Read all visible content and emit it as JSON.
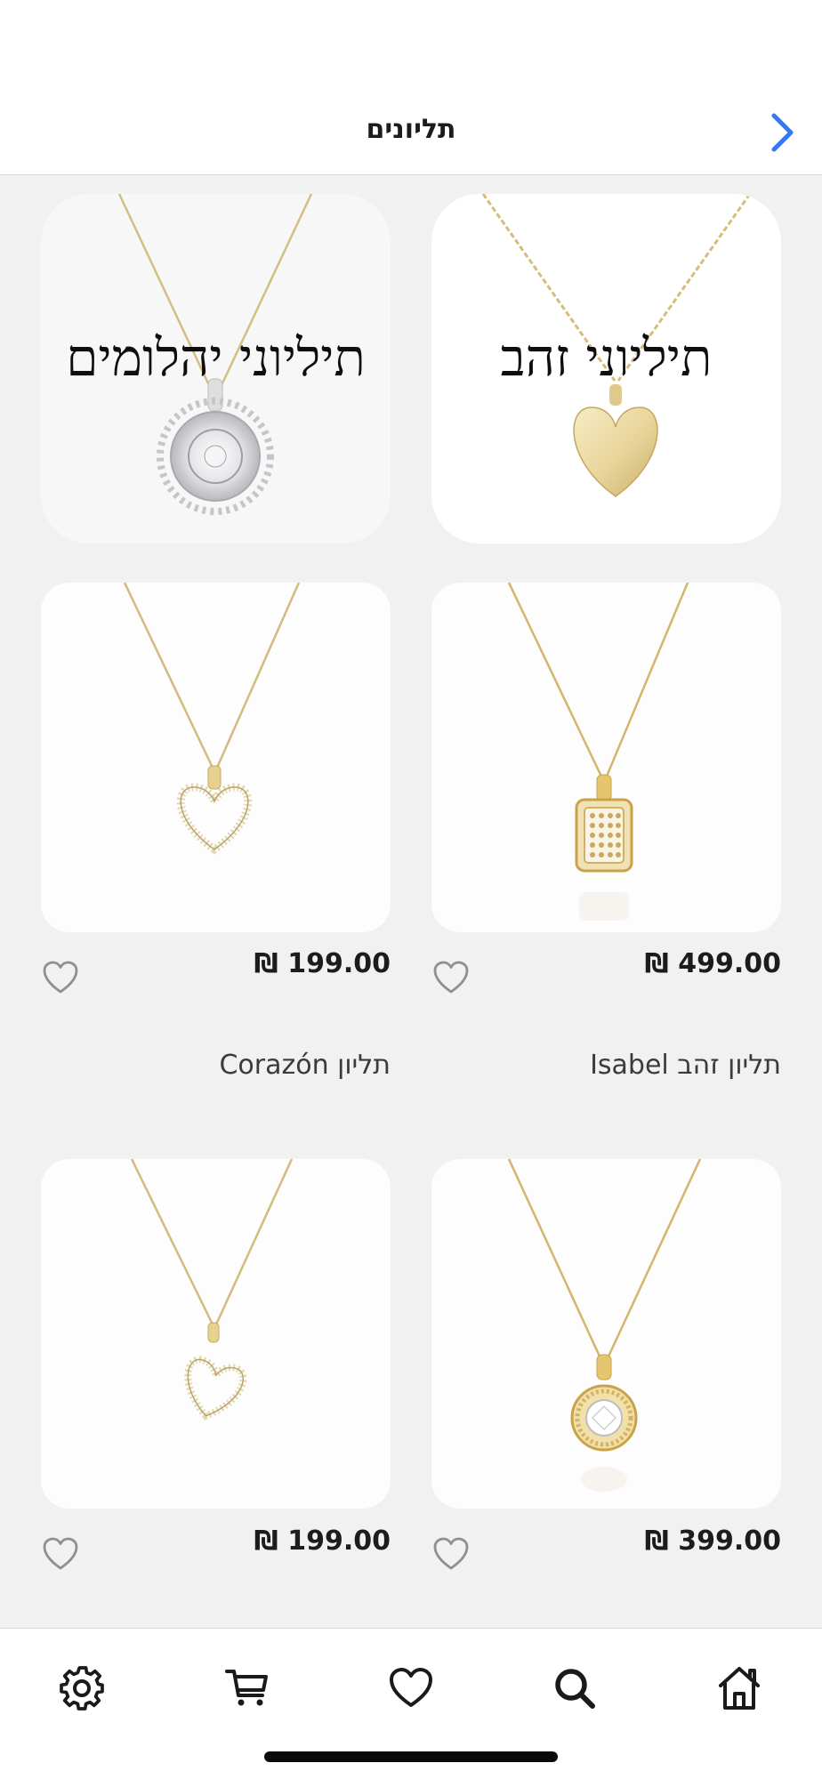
{
  "header": {
    "title": "תליונים",
    "back_icon": "chevron-right-icon",
    "accent": "#3478f6"
  },
  "categories": [
    {
      "label": "תיליוני זהב"
    },
    {
      "label": "תיליוני יהלומים"
    }
  ],
  "products": [
    {
      "price": "₪ 499.00",
      "name": "תליון זהב Isabel",
      "image": "square-pave-pendant"
    },
    {
      "price": "₪ 199.00",
      "name": "תליון Corazón",
      "image": "open-heart-pendant"
    },
    {
      "price": "₪ 399.00",
      "name": "",
      "image": "round-halo-pendant"
    },
    {
      "price": "₪ 199.00",
      "name": "",
      "image": "tilted-heart-pendant"
    }
  ],
  "tab_bar": {
    "tabs": [
      {
        "icon": "home-icon"
      },
      {
        "icon": "search-icon"
      },
      {
        "icon": "heart-icon"
      },
      {
        "icon": "cart-icon"
      },
      {
        "icon": "gear-icon"
      }
    ]
  }
}
